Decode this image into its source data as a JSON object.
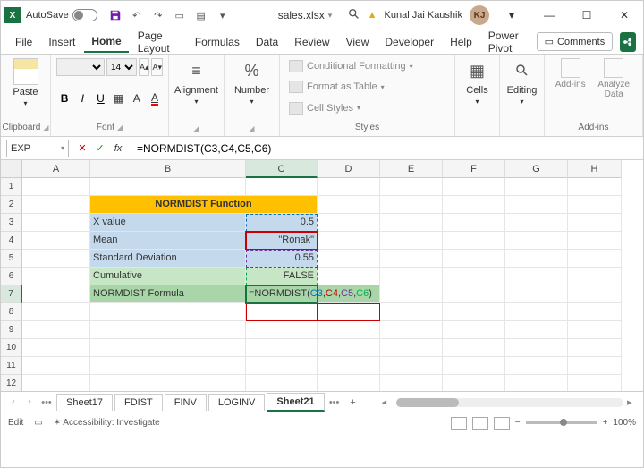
{
  "title": {
    "autosave": "AutoSave",
    "filename": "sales.xlsx",
    "username": "Kunal Jai Kaushik",
    "initials": "KJ"
  },
  "tabs": {
    "file": "File",
    "insert": "Insert",
    "home": "Home",
    "page": "Page Layout",
    "formulas": "Formulas",
    "data": "Data",
    "review": "Review",
    "view": "View",
    "developer": "Developer",
    "help": "Help",
    "powerpivot": "Power Pivot",
    "comments": "Comments"
  },
  "ribbon": {
    "clipboard": {
      "paste": "Paste",
      "label": "Clipboard"
    },
    "font": {
      "size": "14",
      "B": "B",
      "I": "I",
      "U": "U",
      "label": "Font"
    },
    "alignment": {
      "name": "Alignment"
    },
    "number": {
      "name": "Number",
      "pct": "%"
    },
    "styles": {
      "cond": "Conditional Formatting",
      "table": "Format as Table",
      "cell": "Cell Styles",
      "label": "Styles"
    },
    "cells": {
      "name": "Cells"
    },
    "editing": {
      "name": "Editing"
    },
    "addins": {
      "a1": "Add-ins",
      "a2": "Analyze Data",
      "label": "Add-ins"
    }
  },
  "formula": {
    "namebox": "EXP",
    "fx": "fx",
    "value": "=NORMDIST(C3,C4,C5,C6)"
  },
  "cols": [
    "A",
    "B",
    "C",
    "D",
    "E",
    "F",
    "G",
    "H"
  ],
  "rows": [
    "1",
    "2",
    "3",
    "4",
    "5",
    "6",
    "7",
    "8",
    "9",
    "10",
    "11",
    "12"
  ],
  "content": {
    "b2c2": "NORMDIST Function",
    "b3": "X value",
    "c3": "0.5",
    "b4": "Mean",
    "c4": "\"Ronak\"",
    "b5": "Standard Deviation",
    "c5": "0.55",
    "b6": "Cumulative",
    "c6": "FALSE",
    "b7": "NORMDIST Formula",
    "c7_prefix": "=NORMDIST(",
    "c7_a1": "C3",
    "c7_a2": "C4",
    "c7_a3": "C5",
    "c7_a4": "C6",
    "c7_suffix": ")"
  },
  "sheets": {
    "s1": "Sheet17",
    "s2": "FDIST",
    "s3": "FINV",
    "s4": "LOGINV",
    "s5": "Sheet21"
  },
  "status": {
    "mode": "Edit",
    "access": "Accessibility: Investigate",
    "zoom": "100%"
  }
}
